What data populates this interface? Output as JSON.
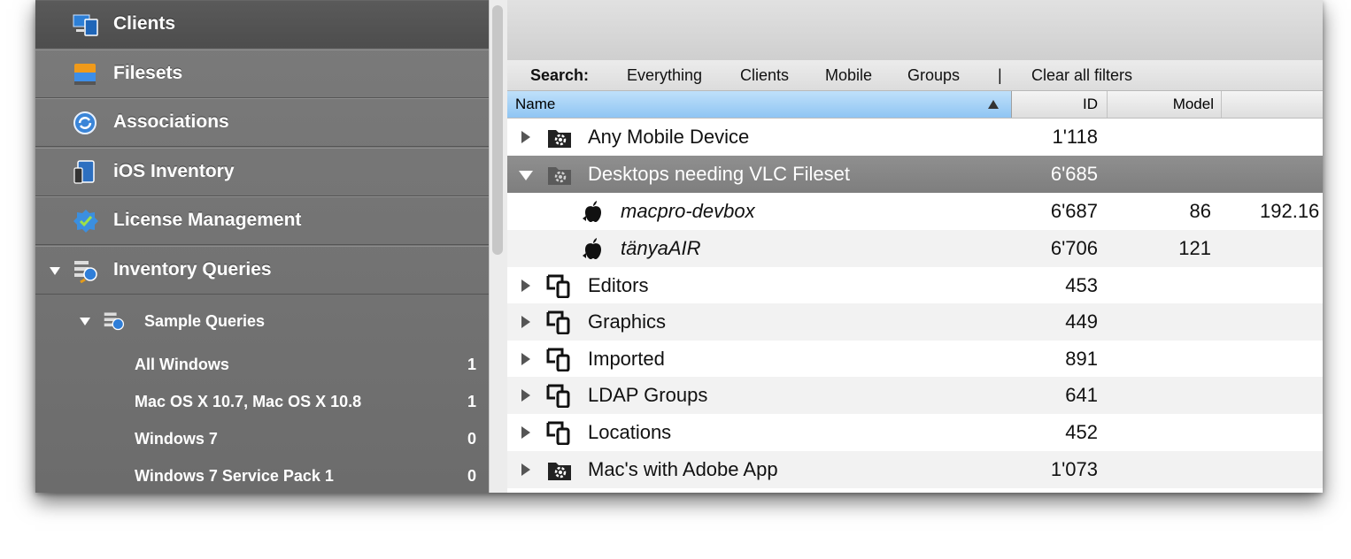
{
  "sidebar": {
    "items": [
      {
        "label": "Clients",
        "icon": "clients-icon"
      },
      {
        "label": "Filesets",
        "icon": "filesets-icon"
      },
      {
        "label": "Associations",
        "icon": "associations-icon"
      },
      {
        "label": "iOS Inventory",
        "icon": "ios-inventory-icon"
      },
      {
        "label": "License Management",
        "icon": "license-management-icon"
      },
      {
        "label": "Inventory Queries",
        "icon": "inventory-queries-icon"
      }
    ],
    "sample_queries": {
      "label": "Sample Queries",
      "icon": "sample-queries-icon"
    },
    "queries": [
      {
        "label": "All Windows",
        "count": "1"
      },
      {
        "label": "Mac OS X 10.7, Mac OS X 10.8",
        "count": "1"
      },
      {
        "label": "Windows 7",
        "count": "0"
      },
      {
        "label": "Windows 7 Service Pack 1",
        "count": "0"
      }
    ]
  },
  "search": {
    "label": "Search:",
    "filters": [
      "Everything",
      "Clients",
      "Mobile",
      "Groups"
    ],
    "separator": "|",
    "clear": "Clear all filters"
  },
  "columns": {
    "name": "Name",
    "id": "ID",
    "model": "Model"
  },
  "rows": [
    {
      "name": "Any Mobile Device",
      "id": "1'118",
      "model": "",
      "extra": "",
      "icon": "smart-group-icon"
    },
    {
      "name": "Desktops needing VLC Fileset",
      "id": "6'685",
      "model": "",
      "extra": "",
      "icon": "smart-group-icon"
    },
    {
      "name": "macpro-devbox",
      "id": "6'687",
      "model": "86",
      "extra": "192.16",
      "icon": "apple-client-icon"
    },
    {
      "name": "tänyaAIR",
      "id": "6'706",
      "model": "121",
      "extra": "",
      "icon": "apple-client-icon"
    },
    {
      "name": "Editors",
      "id": "453",
      "model": "",
      "extra": "",
      "icon": "device-group-icon"
    },
    {
      "name": "Graphics",
      "id": "449",
      "model": "",
      "extra": "",
      "icon": "device-group-icon"
    },
    {
      "name": "Imported",
      "id": "891",
      "model": "",
      "extra": "",
      "icon": "device-group-icon"
    },
    {
      "name": "LDAP Groups",
      "id": "641",
      "model": "",
      "extra": "",
      "icon": "device-group-icon"
    },
    {
      "name": "Locations",
      "id": "452",
      "model": "",
      "extra": "",
      "icon": "device-group-icon"
    },
    {
      "name": "Mac's with Adobe App",
      "id": "1'073",
      "model": "",
      "extra": "",
      "icon": "smart-group-icon"
    }
  ],
  "colors": {
    "sidebar": "#727272",
    "selected_row": "#868686",
    "header_selected": "#a8d2f7"
  }
}
